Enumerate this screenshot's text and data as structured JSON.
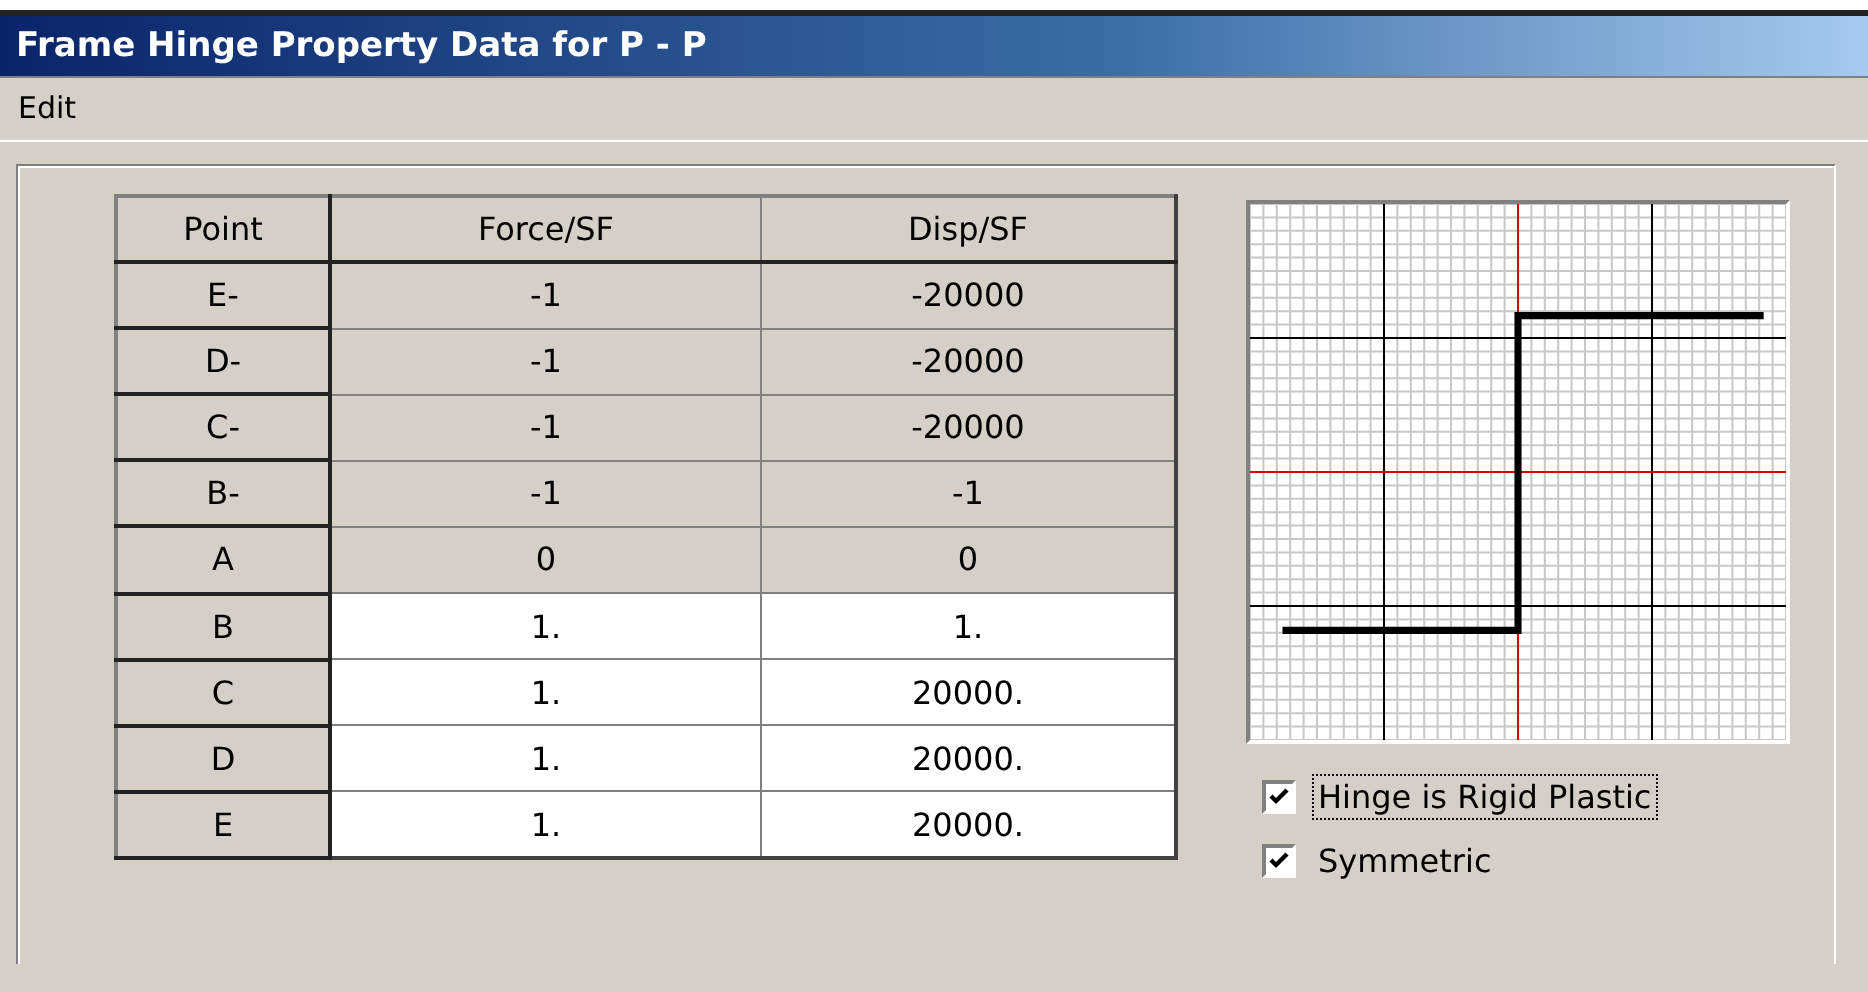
{
  "window": {
    "title": "Frame Hinge Property Data for P - P"
  },
  "menu": [
    "Edit"
  ],
  "table": {
    "columns": [
      "Point",
      "Force/SF",
      "Disp/SF"
    ],
    "rows": [
      {
        "point": "E-",
        "force": "-1",
        "disp": "-20000",
        "editable": false
      },
      {
        "point": "D-",
        "force": "-1",
        "disp": "-20000",
        "editable": false
      },
      {
        "point": "C-",
        "force": "-1",
        "disp": "-20000",
        "editable": false
      },
      {
        "point": "B-",
        "force": "-1",
        "disp": "-1",
        "editable": false
      },
      {
        "point": "A",
        "force": "0",
        "disp": "0",
        "editable": false
      },
      {
        "point": "B",
        "force": "1.",
        "disp": "1.",
        "editable": true
      },
      {
        "point": "C",
        "force": "1.",
        "disp": "20000.",
        "editable": true
      },
      {
        "point": "D",
        "force": "1.",
        "disp": "20000.",
        "editable": true
      },
      {
        "point": "E",
        "force": "1.",
        "disp": "20000.",
        "editable": true
      }
    ]
  },
  "options": [
    {
      "label": "Hinge is Rigid Plastic",
      "checked": true,
      "focused": true
    },
    {
      "label": "Symmetric",
      "checked": true,
      "focused": false
    }
  ]
}
